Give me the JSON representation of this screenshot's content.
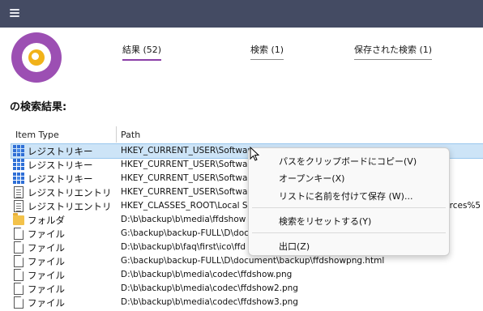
{
  "header": {
    "menu_icon": "hamburger-menu-icon"
  },
  "tabs": [
    {
      "label": "結果 (52)",
      "active": true
    },
    {
      "label": "検索 (1)",
      "active": false
    },
    {
      "label": "保存された検索 (1)",
      "active": false
    }
  ],
  "results_heading": "の検索結果:",
  "columns": {
    "item_type": "Item Type",
    "path": "Path"
  },
  "rows": [
    {
      "type": "レジストリキー",
      "path": "HKEY_CURRENT_USER\\Software",
      "icon": "registry-key-icon"
    },
    {
      "type": "レジストリキー",
      "path": "HKEY_CURRENT_USER\\Software",
      "icon": "registry-key-icon"
    },
    {
      "type": "レジストリキー",
      "path": "HKEY_CURRENT_USER\\Software",
      "icon": "registry-key-icon"
    },
    {
      "type": "レジストリエントリ",
      "path": "HKEY_CURRENT_USER\\Software",
      "icon": "registry-entry-icon"
    },
    {
      "type": "レジストリエントリ",
      "path": "HKEY_CLASSES_ROOT\\Local Sett",
      "path_tail": "urces%5",
      "icon": "registry-entry-icon"
    },
    {
      "type": "フォルダ",
      "path": "D:\\b\\backup\\b\\media\\ffdshow",
      "icon": "folder-icon"
    },
    {
      "type": "ファイル",
      "path": "G:\\backup\\backup-FULL\\D\\doc",
      "icon": "file-icon"
    },
    {
      "type": "ファイル",
      "path": "D:\\b\\backup\\b\\faq\\first\\ico\\ffd",
      "icon": "file-icon"
    },
    {
      "type": "ファイル",
      "path": "G:\\backup\\backup-FULL\\D\\document\\backup\\ffdshowpng.html",
      "icon": "file-icon"
    },
    {
      "type": "ファイル",
      "path": "D:\\b\\backup\\b\\media\\codec\\ffdshow.png",
      "icon": "file-icon"
    },
    {
      "type": "ファイル",
      "path": "D:\\b\\backup\\b\\media\\codec\\ffdshow2.png",
      "icon": "file-icon"
    },
    {
      "type": "ファイル",
      "path": "D:\\b\\backup\\b\\media\\codec\\ffdshow3.png",
      "icon": "file-icon"
    }
  ],
  "context_menu": {
    "copy_path": "パスをクリップボードにコピー(V)",
    "open_key": "オープンキー(X)",
    "save_list": "リストに名前を付けて保存 (W)...",
    "reset_search": "検索をリセットする(Y)",
    "exit": "出口(Z)"
  },
  "colors": {
    "titlebar": "#444b63",
    "accent": "#8b3fa7",
    "selection": "#cde4f7",
    "logo_ring": "#9c4fb3",
    "logo_center": "#f1b21a"
  }
}
